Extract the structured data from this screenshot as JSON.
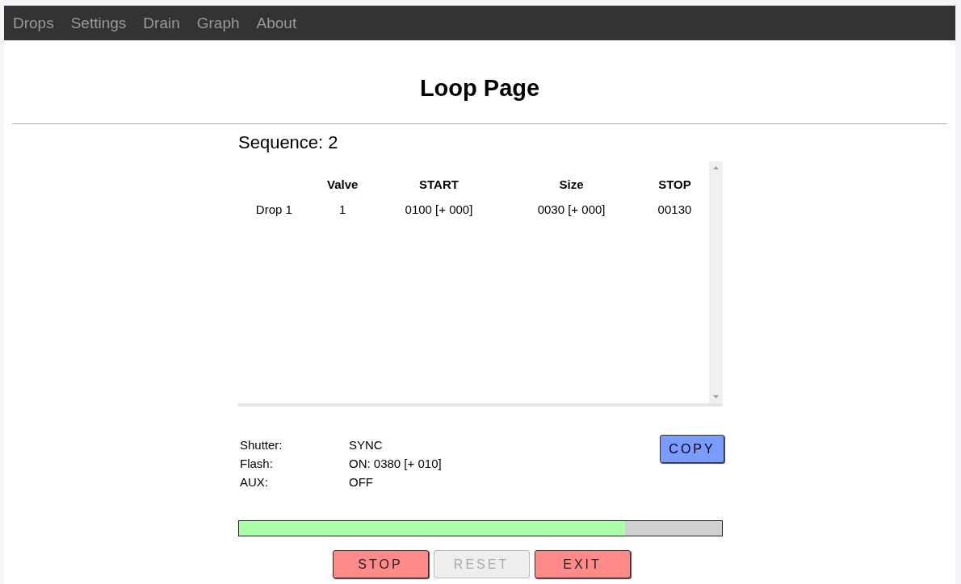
{
  "nav": [
    {
      "label": "Drops"
    },
    {
      "label": "Settings"
    },
    {
      "label": "Drain"
    },
    {
      "label": "Graph"
    },
    {
      "label": "About"
    }
  ],
  "title": "Loop Page",
  "sequence": "Sequence: 2",
  "table": {
    "columns": [
      "",
      "Valve",
      "START",
      "Size",
      "STOP"
    ],
    "rows": [
      [
        "Drop 1",
        "1",
        "0100 [+ 000]",
        "0030 [+ 000]",
        "00130"
      ]
    ]
  },
  "info": [
    {
      "label": "Shutter:",
      "value": "SYNC"
    },
    {
      "label": "Flash:",
      "value": "ON: 0380 [+ 010]"
    },
    {
      "label": "AUX:",
      "value": "OFF"
    }
  ],
  "copy_button": "COPY",
  "progress": {
    "level": 0.8
  },
  "buttons": [
    {
      "label": "STOP",
      "kind": "danger",
      "disabled": false
    },
    {
      "label": "RESET",
      "kind": "neutral",
      "disabled": true
    },
    {
      "label": "EXIT",
      "kind": "danger",
      "disabled": false
    }
  ]
}
